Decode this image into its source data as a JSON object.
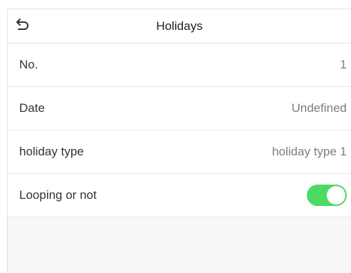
{
  "header": {
    "title": "Holidays",
    "back_icon": "back-arrow-icon"
  },
  "rows": [
    {
      "label": "No.",
      "value": "1"
    },
    {
      "label": "Date",
      "value": "Undefined"
    },
    {
      "label": "holiday type",
      "value": "holiday type 1"
    },
    {
      "label": "Looping or not",
      "toggle_state": "on"
    }
  ],
  "colors": {
    "toggle_on": "#4cd964",
    "value_text": "#7d7d7d"
  }
}
